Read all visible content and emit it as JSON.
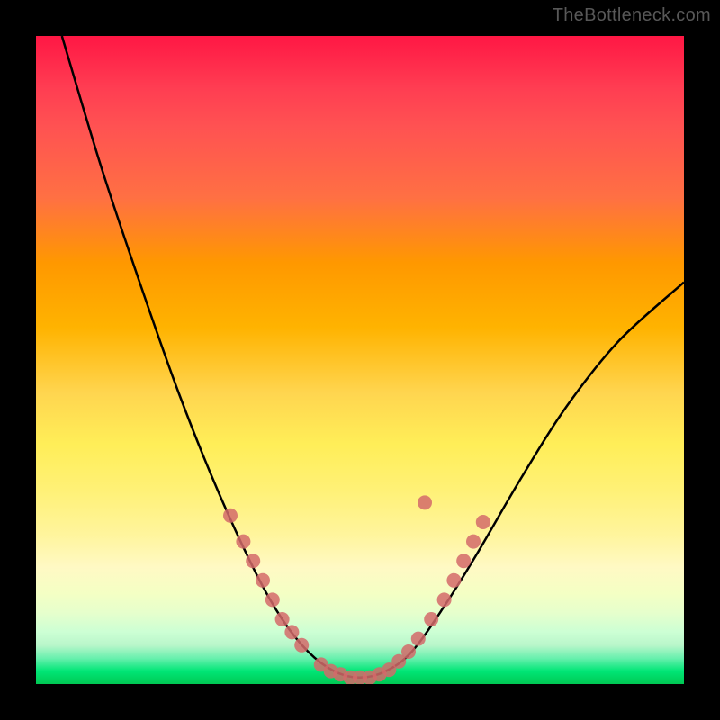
{
  "watermark": "TheBottleneck.com",
  "chart_data": {
    "type": "line",
    "title": "",
    "xlabel": "",
    "ylabel": "",
    "xlim": [
      0,
      100
    ],
    "ylim": [
      0,
      100
    ],
    "curve_points": [
      {
        "x": 4,
        "y": 100
      },
      {
        "x": 10,
        "y": 80
      },
      {
        "x": 16,
        "y": 62
      },
      {
        "x": 22,
        "y": 45
      },
      {
        "x": 28,
        "y": 30
      },
      {
        "x": 34,
        "y": 17
      },
      {
        "x": 38,
        "y": 10
      },
      {
        "x": 42,
        "y": 5
      },
      {
        "x": 46,
        "y": 2
      },
      {
        "x": 50,
        "y": 1
      },
      {
        "x": 54,
        "y": 2
      },
      {
        "x": 58,
        "y": 5
      },
      {
        "x": 63,
        "y": 12
      },
      {
        "x": 68,
        "y": 20
      },
      {
        "x": 75,
        "y": 32
      },
      {
        "x": 82,
        "y": 43
      },
      {
        "x": 90,
        "y": 53
      },
      {
        "x": 100,
        "y": 62
      }
    ],
    "marker_points": [
      {
        "x": 30,
        "y": 26
      },
      {
        "x": 32,
        "y": 22
      },
      {
        "x": 33.5,
        "y": 19
      },
      {
        "x": 35,
        "y": 16
      },
      {
        "x": 36.5,
        "y": 13
      },
      {
        "x": 38,
        "y": 10
      },
      {
        "x": 39.5,
        "y": 8
      },
      {
        "x": 41,
        "y": 6
      },
      {
        "x": 44,
        "y": 3
      },
      {
        "x": 45.5,
        "y": 2
      },
      {
        "x": 47,
        "y": 1.5
      },
      {
        "x": 48.5,
        "y": 1
      },
      {
        "x": 50,
        "y": 1
      },
      {
        "x": 51.5,
        "y": 1
      },
      {
        "x": 53,
        "y": 1.5
      },
      {
        "x": 54.5,
        "y": 2.2
      },
      {
        "x": 56,
        "y": 3.5
      },
      {
        "x": 57.5,
        "y": 5
      },
      {
        "x": 59,
        "y": 7
      },
      {
        "x": 61,
        "y": 10
      },
      {
        "x": 63,
        "y": 13
      },
      {
        "x": 64.5,
        "y": 16
      },
      {
        "x": 66,
        "y": 19
      },
      {
        "x": 67.5,
        "y": 22
      },
      {
        "x": 69,
        "y": 25
      },
      {
        "x": 60,
        "y": 28
      }
    ],
    "marker_color": "#d46a6a",
    "curve_color": "#000000"
  }
}
